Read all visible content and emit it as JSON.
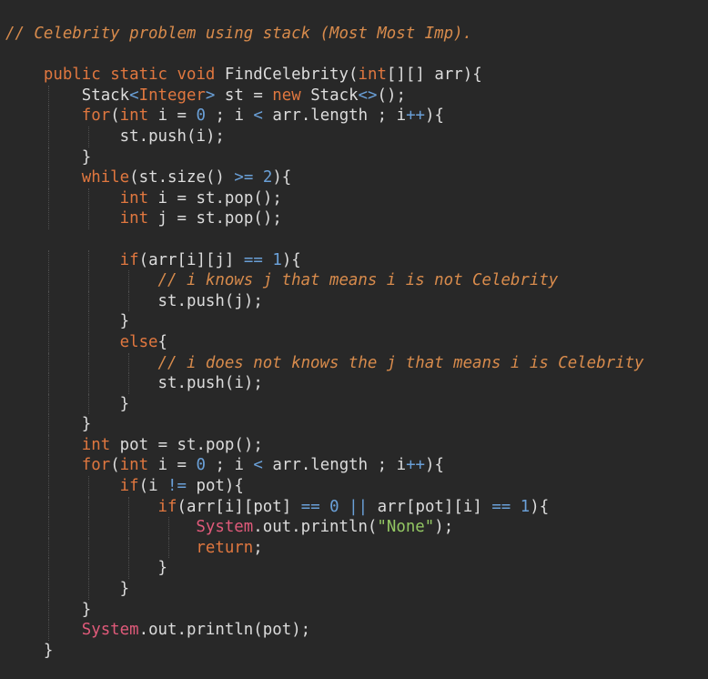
{
  "editor": {
    "lines": [
      "// Celebrity problem using stack (Most Most Imp).",
      "",
      "    public static void FindCelebrity(int[][] arr){",
      "        Stack<Integer> st = new Stack<>();",
      "        for(int i = 0 ; i < arr.length ; i++){",
      "            st.push(i);",
      "        }",
      "        while(st.size() >= 2){",
      "            int i = st.pop();",
      "            int j = st.pop();",
      "",
      "            if(arr[i][j] == 1){",
      "                // i knows j that means i is not Celebrity",
      "                st.push(j);",
      "            }",
      "            else{",
      "                // i does not knows the j that means i is Celebrity",
      "                st.push(i);",
      "            }",
      "        }",
      "        int pot = st.pop();",
      "        for(int i = 0 ; i < arr.length ; i++){",
      "            if(i != pot){",
      "                if(arr[i][pot] == 0 || arr[pot][i] == 1){",
      "                    System.out.println(\"None\");",
      "                    return;",
      "                }",
      "            }",
      "        }",
      "        System.out.println(pot);",
      "    }"
    ]
  },
  "colors": {
    "background": "#282828",
    "comment": "#d88b4c",
    "keyword": "#e0773f",
    "number": "#6aa0d8",
    "string": "#93c763",
    "system": "#e05a7a",
    "text": "#dcdcdc"
  }
}
